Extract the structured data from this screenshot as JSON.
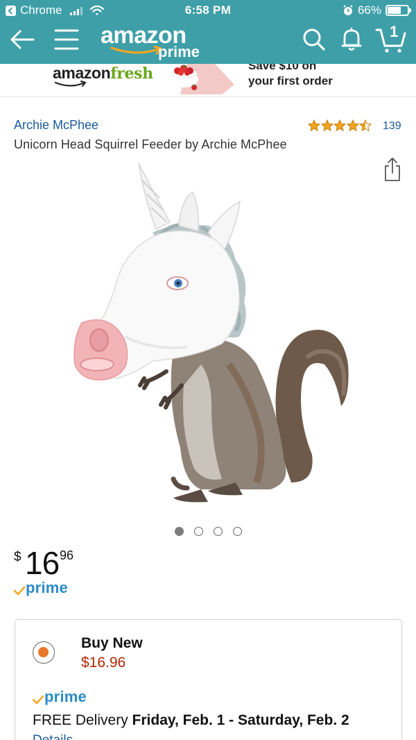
{
  "status_bar": {
    "back_app": "Chrome",
    "time": "6:58 PM",
    "battery": "66%"
  },
  "nav": {
    "logo_main": "amazon",
    "logo_sub": "prime",
    "cart_count": "1"
  },
  "banner": {
    "fresh_brand_a": "amazon",
    "fresh_brand_b": "fresh",
    "promo_line1": "Save $10 on",
    "promo_line2": "your first order"
  },
  "product": {
    "brand": "Archie McPhee",
    "title": "Unicorn Head Squirrel Feeder by Archie McPhee",
    "rating": 4.5,
    "review_count": "139",
    "image_count": 4,
    "image_index": 1,
    "price_symbol": "$",
    "price_whole": "16",
    "price_fraction": "96",
    "prime_label": "prime"
  },
  "buy_box": {
    "option_label": "Buy New",
    "option_price": "$16.96",
    "prime_label": "prime",
    "delivery_prefix": "FREE Delivery ",
    "delivery_dates": "Friday, Feb. 1 - Saturday, Feb. 2",
    "details_link": "Details"
  },
  "colors": {
    "header": "#3f9fa8",
    "link": "#1a5a9a",
    "price_red": "#b12704",
    "radio_orange": "#e8792a",
    "star": "#f0a41c",
    "prime_blue": "#2a8bc6"
  }
}
